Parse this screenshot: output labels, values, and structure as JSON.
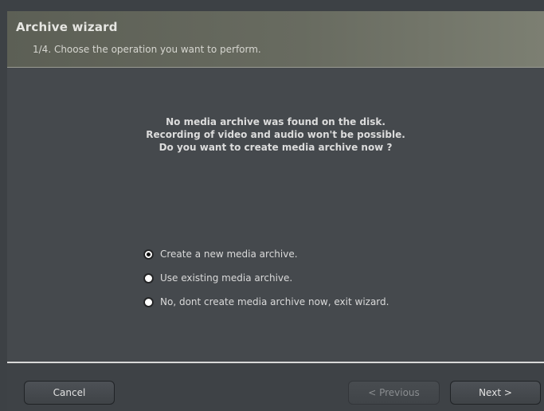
{
  "header": {
    "title": "Archive wizard",
    "subtitle": "1/4. Choose the operation you want to perform."
  },
  "message": {
    "lines": [
      "No media archive was found on the disk.",
      "Recording of video and audio won't be possible.",
      "Do you want to create media archive now ?"
    ]
  },
  "options": [
    {
      "label": "Create a new media archive.",
      "selected": true
    },
    {
      "label": "Use existing media archive.",
      "selected": false
    },
    {
      "label": "No, dont create media archive now, exit wizard.",
      "selected": false
    }
  ],
  "footer": {
    "cancel_label": "Cancel",
    "previous_label": "< Previous",
    "previous_enabled": false,
    "next_label": "Next >"
  },
  "colors": {
    "background": "#45494d",
    "header_gradient_start": "#5c5f55",
    "header_gradient_end": "#7c7f72",
    "text": "#dcdcdc",
    "disabled_text": "#8a8d90"
  }
}
